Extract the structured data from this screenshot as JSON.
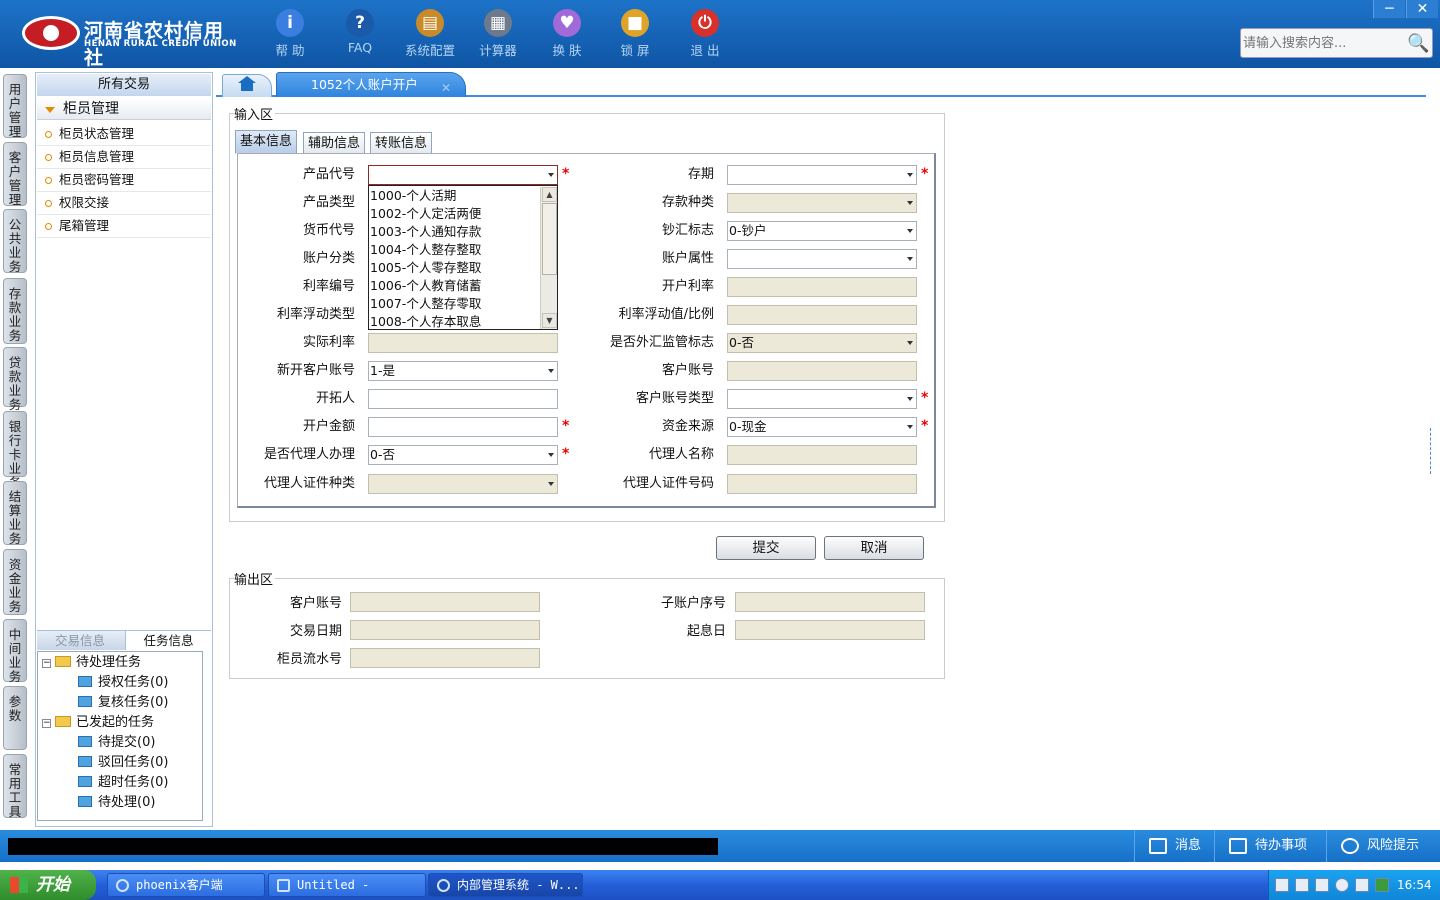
{
  "app": {
    "logo_cn": "河南省农村信用社",
    "logo_en": "HENAN RURAL CREDIT UNION"
  },
  "toolbar": [
    {
      "label": "帮 助",
      "icon": "info-icon",
      "glyph": "i",
      "color": "#3a7fe0"
    },
    {
      "label": "FAQ",
      "icon": "question-icon",
      "glyph": "?",
      "color": "#1b5aa8"
    },
    {
      "label": "系统配置",
      "icon": "toolbox-icon",
      "glyph": "▤",
      "color": "#c98a2a"
    },
    {
      "label": "计算器",
      "icon": "calculator-icon",
      "glyph": "▦",
      "color": "#6c7a8c"
    },
    {
      "label": "换 肤",
      "icon": "shirt-icon",
      "glyph": "♥",
      "color": "#a06ad8"
    },
    {
      "label": "锁 屏",
      "icon": "lock-icon",
      "glyph": "■",
      "color": "#e0a32a"
    },
    {
      "label": "退 出",
      "icon": "power-icon",
      "glyph": "⏻",
      "color": "#d8302a"
    }
  ],
  "window": {
    "min": "─",
    "close": "✕"
  },
  "search": {
    "placeholder": "请输入搜索内容..."
  },
  "vtabs": [
    "用户管理",
    "客户管理",
    "公共业务",
    "存款业务",
    "贷款业务",
    "银行卡业务",
    "结算业务",
    "资金业务",
    "中间业务",
    "参数",
    "常用工具"
  ],
  "nav": {
    "title": "所有交易",
    "group": "柜员管理",
    "items": [
      "柜员状态管理",
      "柜员信息管理",
      "柜员密码管理",
      "权限交接",
      "尾箱管理"
    ]
  },
  "info_tabs": [
    "交易信息",
    "任务信息"
  ],
  "tree": {
    "pending": "待处理任务",
    "pending_items": [
      "授权任务(0)",
      "复核任务(0)"
    ],
    "started": "已发起的任务",
    "started_items": [
      "待提交(0)",
      "驳回任务(0)",
      "超时任务(0)",
      "待处理(0)"
    ]
  },
  "tabs": {
    "page": "1052个人账户开户",
    "close": "✕"
  },
  "input_area": {
    "legend": "输入区",
    "subtabs": [
      "基本信息",
      "辅助信息",
      "转账信息"
    ]
  },
  "form_left": [
    {
      "label": "产品代号",
      "value": ""
    },
    {
      "label": "产品类型",
      "value": ""
    },
    {
      "label": "货币代号",
      "value": ""
    },
    {
      "label": "账户分类",
      "value": ""
    },
    {
      "label": "利率编号",
      "value": ""
    },
    {
      "label": "利率浮动类型",
      "value": ""
    },
    {
      "label": "实际利率",
      "value": ""
    },
    {
      "label": "新开客户账号",
      "value": "1-是"
    },
    {
      "label": "开拓人",
      "value": ""
    },
    {
      "label": "开户金额",
      "value": ""
    },
    {
      "label": "是否代理人办理",
      "value": "0-否"
    },
    {
      "label": "代理人证件种类",
      "value": ""
    }
  ],
  "form_right": [
    {
      "label": "存期",
      "value": ""
    },
    {
      "label": "存款种类",
      "value": ""
    },
    {
      "label": "钞汇标志",
      "value": "0-钞户"
    },
    {
      "label": "账户属性",
      "value": ""
    },
    {
      "label": "开户利率",
      "value": ""
    },
    {
      "label": "利率浮动值/比例",
      "value": ""
    },
    {
      "label": "是否外汇监管标志",
      "value": "0-否"
    },
    {
      "label": "客户账号",
      "value": ""
    },
    {
      "label": "客户账号类型",
      "value": ""
    },
    {
      "label": "资金来源",
      "value": "0-现金"
    },
    {
      "label": "代理人名称",
      "value": ""
    },
    {
      "label": "代理人证件号码",
      "value": ""
    }
  ],
  "dropdown": [
    "1000-个人活期",
    "1002-个人定活两便",
    "1003-个人通知存款",
    "1004-个人整存整取",
    "1005-个人零存整取",
    "1006-个人教育储蓄",
    "1007-个人整存零取",
    "1008-个人存本取息"
  ],
  "required_mark": "*",
  "buttons": {
    "submit": "提交",
    "cancel": "取消"
  },
  "output_area": {
    "legend": "输出区",
    "fields": [
      {
        "label": "客户账号",
        "value": ""
      },
      {
        "label": "子账户序号",
        "value": ""
      },
      {
        "label": "交易日期",
        "value": ""
      },
      {
        "label": "起息日",
        "value": ""
      },
      {
        "label": "柜员流水号",
        "value": ""
      }
    ]
  },
  "statusbar": {
    "message": "消息",
    "todo": "待办事项",
    "risk": "风险提示"
  },
  "taskbar": {
    "start": "开始",
    "tasks": [
      "phoenix客户端",
      "Untitled - IDCheck",
      "内部管理系统 - W..."
    ],
    "clock": "16:54"
  }
}
